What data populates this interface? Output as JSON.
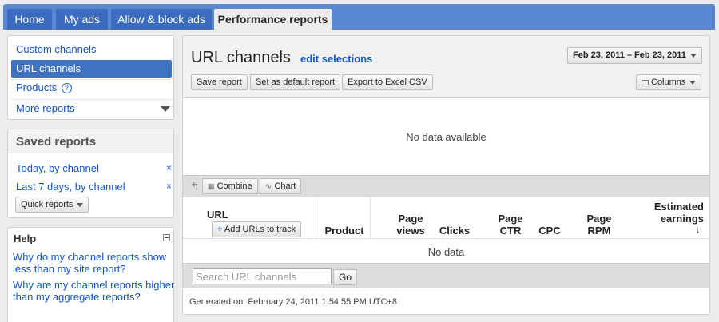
{
  "nav": {
    "tabs": [
      {
        "label": "Home"
      },
      {
        "label": "My ads"
      },
      {
        "label": "Allow & block ads"
      },
      {
        "label": "Performance reports"
      }
    ]
  },
  "sidebar": {
    "items": [
      {
        "label": "Custom channels"
      },
      {
        "label": "URL channels"
      },
      {
        "label": "Products"
      },
      {
        "label": "More reports"
      }
    ]
  },
  "saved_reports": {
    "title": "Saved reports",
    "items": [
      {
        "label": "Today, by channel",
        "remove": "×"
      },
      {
        "label": "Last 7 days, by channel",
        "remove": "×"
      }
    ],
    "quick_label": "Quick reports"
  },
  "help": {
    "title": "Help",
    "links": [
      {
        "label": "Why do my channel reports show less than my site report?"
      },
      {
        "label": "Why are my channel reports higher than my aggregate reports?"
      }
    ]
  },
  "main": {
    "title": "URL channels",
    "edit_label": "edit selections",
    "date_range": "Feb 23, 2011 – Feb 23, 2011",
    "buttons": {
      "save": "Save report",
      "default": "Set as default report",
      "export": "Export to Excel CSV",
      "columns": "Columns"
    },
    "no_data_available": "No data available",
    "toolbar": {
      "combine": "Combine",
      "chart": "Chart"
    },
    "table": {
      "columns": {
        "url": "URL",
        "add_urls": "Add URLs to track",
        "product": "Product",
        "page_views": "Page views",
        "clicks": "Clicks",
        "page_ctr": "Page CTR",
        "cpc": "CPC",
        "page_rpm": "Page RPM",
        "estimated_earnings": "Estimated earnings"
      },
      "no_data": "No data"
    },
    "search": {
      "placeholder": "Search URL channels",
      "value": "",
      "go": "Go"
    },
    "generated": "Generated on: February 24, 2011 1:54:55 PM UTC+8"
  },
  "colors": {
    "nav_bar": "#5a87d1",
    "tab": "#3c6cbf",
    "selected": "#3f72c0",
    "link": "#1155cc"
  }
}
